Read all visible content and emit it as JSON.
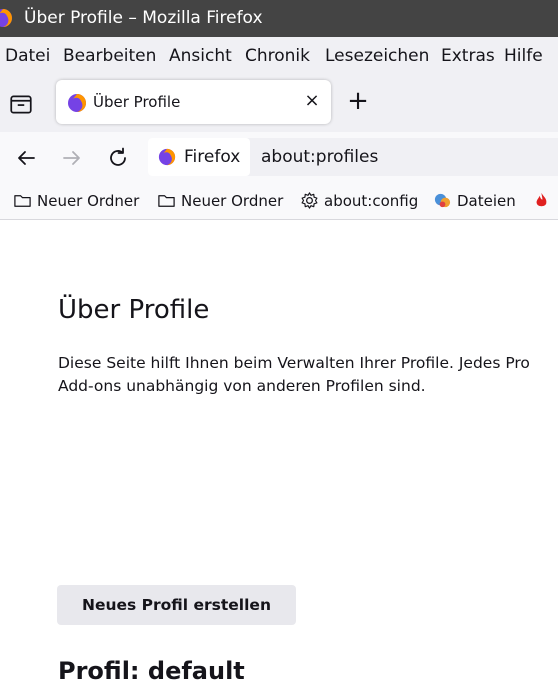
{
  "window": {
    "title": "Über Profile – Mozilla Firefox"
  },
  "menu": [
    {
      "label": "Datei"
    },
    {
      "label": "Bearbeiten"
    },
    {
      "label": "Ansicht"
    },
    {
      "label": "Chronik"
    },
    {
      "label": "Lesezeichen"
    },
    {
      "label": "Extras"
    },
    {
      "label": "Hilfe"
    }
  ],
  "tab": {
    "label": "Über Profile",
    "close": "×"
  },
  "newtab": "+",
  "url": {
    "identity": "Firefox",
    "text": "about:profiles"
  },
  "bookmarks": [
    {
      "label": "Neuer Ordner",
      "icon": "folder-icon"
    },
    {
      "label": "Neuer Ordner",
      "icon": "folder-icon"
    },
    {
      "label": "about:config",
      "icon": "gear-icon"
    },
    {
      "label": "Dateien",
      "icon": "files-icon"
    }
  ],
  "page": {
    "title": "Über Profile",
    "desc_line1": "Diese Seite hilft Ihnen beim Verwalten Ihrer Profile. Jedes Pro",
    "desc_line2": "Add-ons unabhängig von anderen Profilen sind.",
    "new_profile_button": "Neues Profil erstellen",
    "profile_heading": "Profil: default"
  },
  "colors": {
    "titlebar": "#444444",
    "chrome": "#f0f0f4",
    "toolbar": "#f9f9fb",
    "button": "#e8e8ed"
  }
}
